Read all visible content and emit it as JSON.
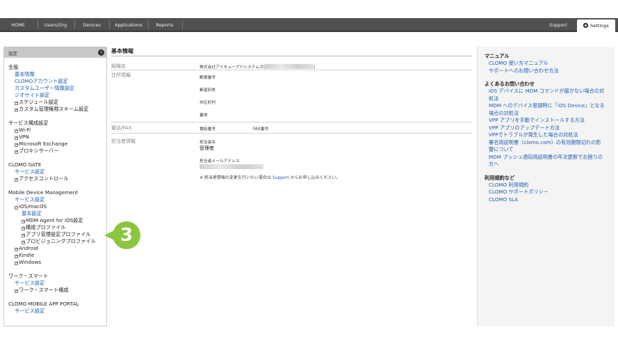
{
  "nav": {
    "items": [
      "HOME",
      "Users/Org",
      "Devices",
      "Applications",
      "Reports"
    ],
    "support": "Support",
    "settings": "Settings"
  },
  "sidebar": {
    "header": "設定",
    "s1": {
      "title": "全般",
      "items": [
        "基本情報",
        "CLOMOアカウント設定",
        "カスタムユーザー情報設定",
        "ジオサイト設定"
      ],
      "nodes": [
        "スケジュール設定",
        "カスタム管理権限スキーム設定"
      ]
    },
    "s2": {
      "title": "サービス構成設定",
      "nodes": [
        "Wi-Fi",
        "VPN",
        "Microsoft Exchange",
        "プロキシサーバー"
      ]
    },
    "s3": {
      "title": "CLOMO GATE",
      "link": "サービス設定",
      "node": "アクセスコントロール"
    },
    "s4": {
      "title": "Mobile Device Management",
      "link": "サービス設定",
      "ios": "iOS/macOS",
      "ios_link": "基本設定",
      "ios_children": [
        "MDM Agent for iOS設定",
        "構成プロファイル",
        "アプリ管理設定プロファイル",
        "プロビジョニングプロファイル"
      ],
      "others": [
        "Android",
        "Kindle",
        "Windows"
      ]
    },
    "s5": {
      "title": "ワーク・スマート",
      "link": "サービス設定",
      "node": "ワーク・スマート構成"
    },
    "s6": {
      "title": "CLOMO MOBILE APP PORTAL",
      "link": "サービス設定"
    }
  },
  "callout": {
    "number": "3"
  },
  "main": {
    "title": "基本情報",
    "org_label": "組織名",
    "org_value_prefix": "株式会社アイキューブドシステムズ(",
    "org_value_suffix": ")",
    "addr_label": "住所情報",
    "zip": "郵便番号",
    "pref": "都道府県",
    "city": "市区町村",
    "street": "番地",
    "phone_label": "電話/FAX",
    "tel": "電話番号",
    "fax": "FAX番号",
    "admin_label": "担当者情報",
    "admin_name_label": "担当者名",
    "admin_name": "管理者",
    "admin_mail_label": "担当者メールアドレス",
    "note_prefix": "※ 担当者情報の変更を行いたい場合は ",
    "note_link": "Support",
    "note_suffix": " からお申し込みください。"
  },
  "right": {
    "h1": "マニュアル",
    "manual": [
      "CLOMO 使い方マニュアル",
      "サポートへのお問い合わせ方法"
    ],
    "h2": "よくあるお問い合わせ",
    "faq": [
      "iOS デバイスに MDM コマンドが届かない場合の対",
      "処法",
      "MDM へのデバイス登録時に「iOS Device」となる",
      "場合の対処法",
      "VPP アプリを手動でインストールする方法",
      "VPP アプリのアップデート方法",
      "VPPでトラブルが発生した場合の対処法",
      "署名用証明書（clomo.com）の有効期限切れの影",
      "響について",
      "MDM プッシュ通知用証明書の年次更新でお困りの",
      "方へ"
    ],
    "h3": "利用規約など",
    "terms": [
      "CLOMO 利用規約",
      "CLOMO サポートポリシー",
      "CLOMO SLA"
    ]
  }
}
